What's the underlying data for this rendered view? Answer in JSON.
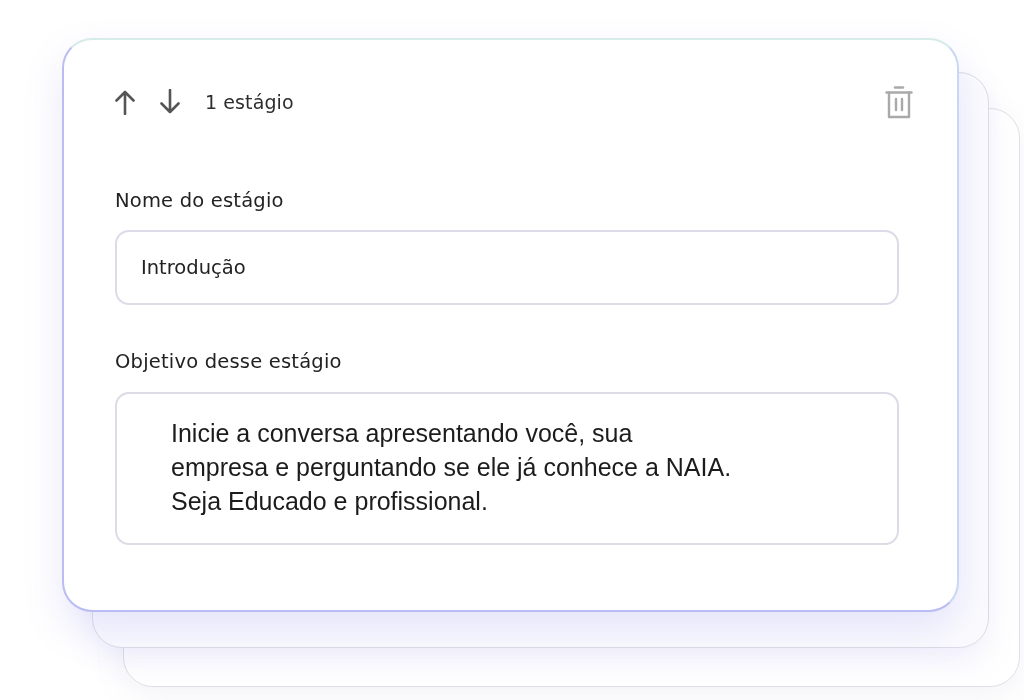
{
  "card": {
    "stage_count": "1 estágio",
    "fields": [
      {
        "kind": "input",
        "label": "Nome do estágio",
        "value": "Introdução"
      },
      {
        "kind": "textarea",
        "label": "Objetivo desse estágio",
        "value": "Inicie a conversa apresentando você, sua\nempresa e perguntando se ele já conhece a NAIA.\nSeja Educado e profissional."
      }
    ]
  }
}
